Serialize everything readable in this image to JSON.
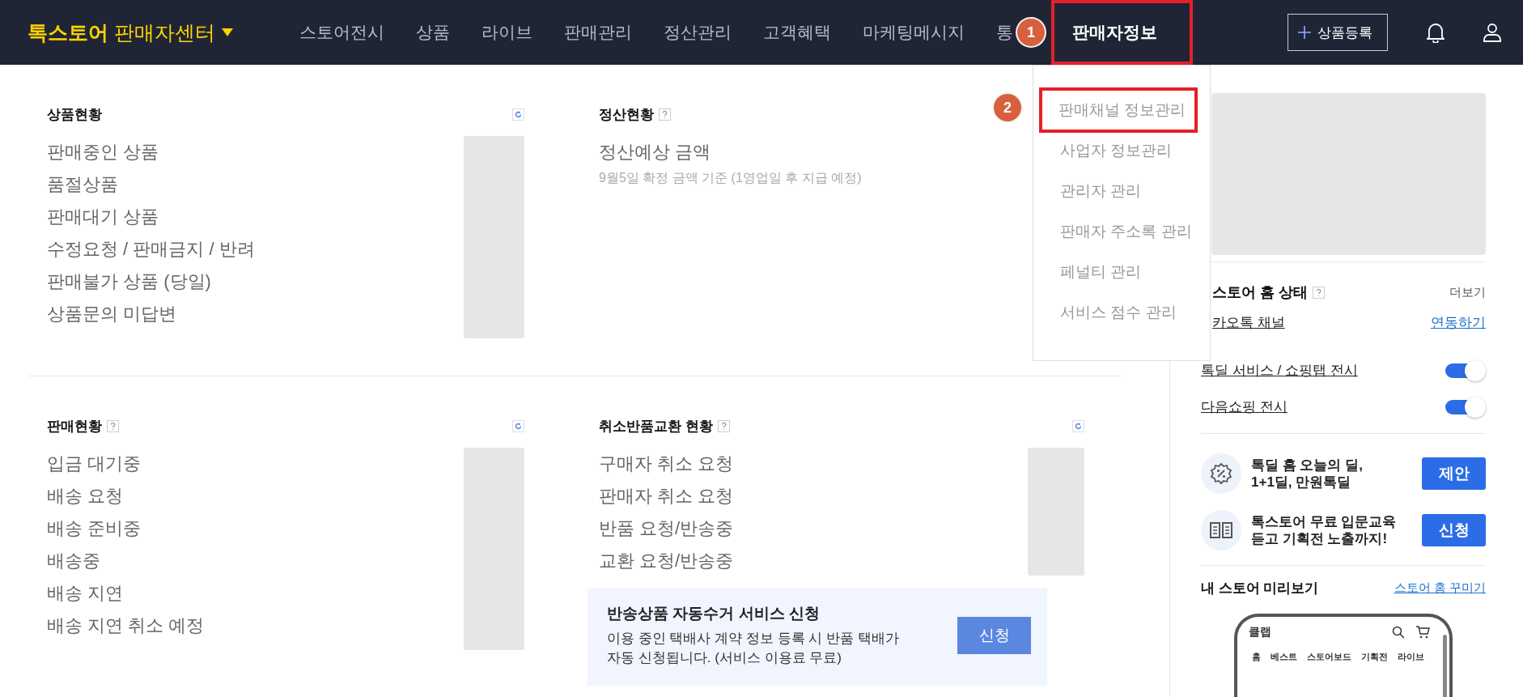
{
  "header": {
    "logo_bold": "톡스토어",
    "logo_rest": "판매자센터",
    "nav": [
      {
        "label": "스토어전시",
        "selected": false
      },
      {
        "label": "상품",
        "selected": false
      },
      {
        "label": "라이브",
        "selected": false
      },
      {
        "label": "판매관리",
        "selected": false
      },
      {
        "label": "정산관리",
        "selected": false
      },
      {
        "label": "고객혜택",
        "selected": false
      },
      {
        "label": "마케팅메시지",
        "selected": false
      },
      {
        "label": "통",
        "selected": false
      },
      {
        "label": "판매자정보",
        "selected": true,
        "badge": "1"
      }
    ],
    "register_button": "상품등록"
  },
  "menu": {
    "items": [
      {
        "label": "판매채널 정보관리",
        "highlighted": true,
        "badge": "2"
      },
      {
        "label": "사업자 정보관리",
        "highlighted": false
      },
      {
        "label": "관리자 관리",
        "highlighted": false
      },
      {
        "label": "판매자 주소록 관리",
        "highlighted": false
      },
      {
        "label": "페널티 관리",
        "highlighted": false
      },
      {
        "label": "서비스 점수 관리",
        "highlighted": false
      }
    ]
  },
  "sections": [
    {
      "title": "상품현황",
      "help": false,
      "refresh": true,
      "items": [
        "판매중인 상품",
        "품절상품",
        "판매대기 상품",
        "수정요청 / 판매금지 / 반려",
        "판매불가 상품 (당일)",
        "상품문의 미답변"
      ]
    },
    {
      "title": "정산현황",
      "help": true,
      "refresh": false,
      "items": [
        "정산예상 금액"
      ],
      "note": "9월5일 확정 금액 기준 (1영업일 후 지급 예정)"
    },
    {
      "title": "판매현황",
      "help": true,
      "refresh": true,
      "items": [
        "입금 대기중",
        "배송 요청",
        "배송 준비중",
        "배송중",
        "배송 지연",
        "배송 지연 취소 예정"
      ]
    },
    {
      "title": "취소반품교환 현황",
      "help": true,
      "refresh": true,
      "items": [
        "구매자 취소 요청",
        "판매자 취소 요청",
        "반품 요청/반송중",
        "교환 요청/반송중"
      ],
      "promo": {
        "title": "반송상품 자동수거 서비스 신청",
        "lines": [
          "이용 중인 택배사 계약 정보 등록 시 반품 택배가",
          "자동 신청됩니다. (서비스 이용료 무료)"
        ],
        "button": "신청"
      }
    }
  ],
  "sidebar": {
    "status": {
      "title": "스토어 홈 상태",
      "help": true,
      "more": "더보기",
      "rows": [
        {
          "kind": "link",
          "label": "카오톡 채널",
          "action": "연동하기"
        },
        {
          "kind": "toggle",
          "label": "톡딜 서비스 / 쇼핑탭 전시",
          "on": true
        },
        {
          "kind": "toggle",
          "label": "다음쇼핑 전시",
          "on": true
        }
      ]
    },
    "promos": [
      {
        "kind": "deal",
        "lines": [
          "톡딜 홈 오늘의 딜,",
          "1+1딜, 만원톡딜"
        ],
        "button": "제안"
      },
      {
        "kind": "education",
        "lines": [
          "톡스토어 무료 입문교육",
          "듣고 기획전 노출까지!"
        ],
        "button": "신청"
      }
    ],
    "preview": {
      "title": "내 스토어 미리보기",
      "link": "스토어 홈 꾸미기",
      "phone": {
        "shop_name": "클랩",
        "tabs": [
          "홈",
          "베스트",
          "스토어보드",
          "기획전",
          "라이브"
        ]
      }
    }
  }
}
